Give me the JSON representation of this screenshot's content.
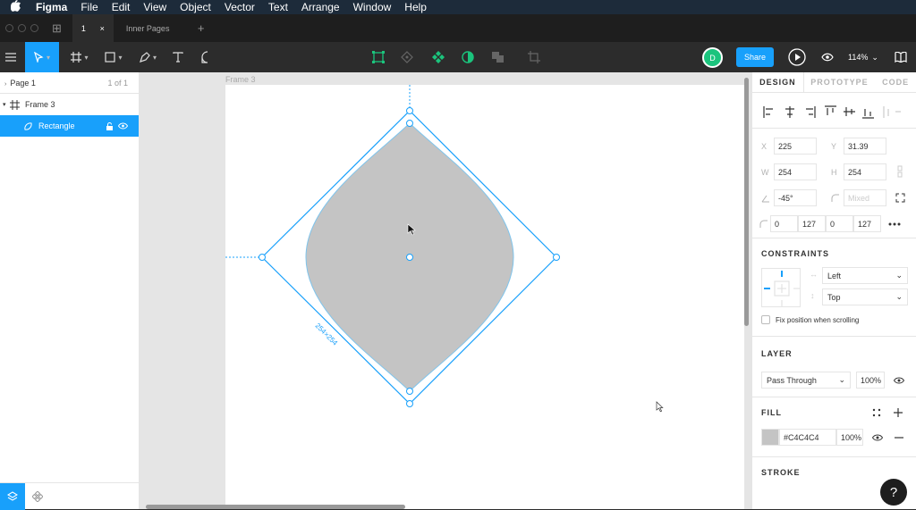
{
  "menubar": {
    "apple": "",
    "items": [
      "Figma",
      "File",
      "Edit",
      "View",
      "Object",
      "Vector",
      "Text",
      "Arrange",
      "Window",
      "Help"
    ]
  },
  "tabs": {
    "grid": "⊞",
    "active_label": "1",
    "active_close": "×",
    "inner_label": "Inner Pages",
    "plus": "+"
  },
  "toolbar": {
    "avatar": "D",
    "share_label": "Share",
    "zoom": "114%",
    "zoom_caret": "⌄"
  },
  "layers": {
    "page_name": "Page 1",
    "page_count": "1 of 1",
    "frame_name": "Frame 3",
    "rect_name": "Rectangle"
  },
  "canvas": {
    "frame_label": "Frame 3",
    "size_label": "254×254",
    "fill_color": "#C4C4C4",
    "selection_color": "#18a0fb"
  },
  "design": {
    "tabs": [
      "DESIGN",
      "PROTOTYPE",
      "CODE"
    ],
    "x_label": "X",
    "x": "225",
    "y_label": "Y",
    "y": "31.39",
    "w_label": "W",
    "w": "254",
    "h_label": "H",
    "h": "254",
    "rotation": "-45°",
    "radius": "Mixed",
    "corners": [
      "0",
      "127",
      "0",
      "127"
    ],
    "constraints_title": "CONSTRAINTS",
    "constraint_h": "Left",
    "constraint_v": "Top",
    "fix_label": "Fix position when scrolling",
    "layer_title": "LAYER",
    "blend": "Pass Through",
    "layer_opacity": "100%",
    "fill_title": "FILL",
    "fill_hex": "#C4C4C4",
    "fill_opacity": "100%",
    "stroke_title": "STROKE"
  },
  "help": "?"
}
